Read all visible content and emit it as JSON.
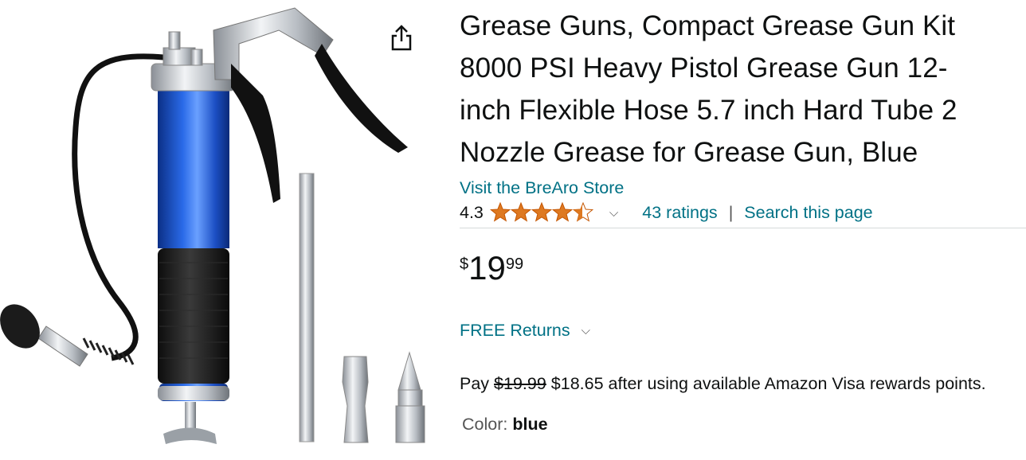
{
  "product": {
    "title": "Grease Guns, Compact Grease Gun Kit 8000 PSI Heavy Pistol Grease Gun 12-inch Flexible Hose 5.7 inch Hard Tube 2 Nozzle Grease for Grease Gun, Blue",
    "title_lines": [
      "Grease Guns, Compact Grease Gun Kit",
      "8000 PSI Heavy Pistol Grease Gun 12-",
      "inch Flexible Hose 5.7 inch Hard Tube 2",
      "Nozzle Grease for Grease Gun, Blue"
    ],
    "store_link": "Visit the BreAro Store",
    "rating": "4.3",
    "rating_stars": 4.3,
    "ratings_count": "43 ratings",
    "search_page": "Search this page",
    "separator": "|"
  },
  "price": {
    "currency": "$",
    "whole": "19",
    "fraction": "99"
  },
  "returns": {
    "label": "FREE Returns"
  },
  "pay": {
    "prefix": "Pay",
    "old_price": "$19.99",
    "new_price": "$18.65",
    "suffix": "after using available Amazon Visa rewards points."
  },
  "color": {
    "label": "Color:",
    "value": "blue"
  },
  "icons": {
    "share": "share-icon",
    "star": "star-icon",
    "chevron": "chevron-down-icon"
  },
  "colors": {
    "link": "#007185",
    "star": "#de7921",
    "tube_blue": "#1f56c9"
  }
}
